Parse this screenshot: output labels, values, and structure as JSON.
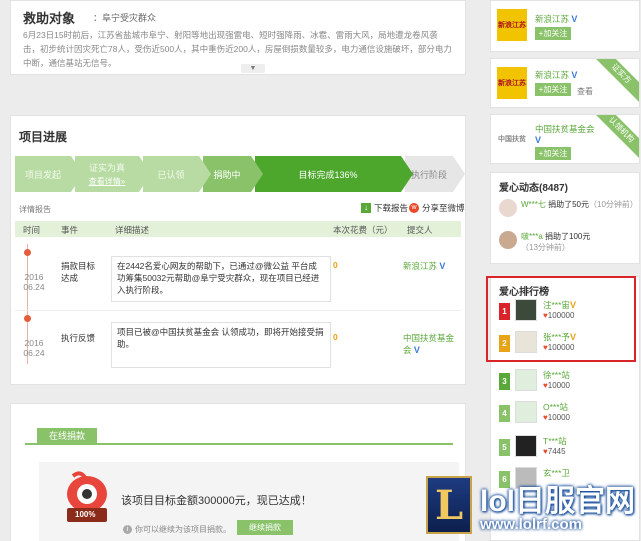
{
  "rescue": {
    "title": "救助对象",
    "subject": "：阜宁受灾群众",
    "description": "6月23日15时前后，江苏省盐城市阜宁、射阳等地出现强雷电、短时强降雨、冰雹、雷雨大风，局地遭龙卷风袭击，初步统计因灾死亡78人，受伤近500人，其中重伤近200人，房屋倒损数量较多，电力通信设施破坏，部分电力中断，通信基站无信号。"
  },
  "progress": {
    "title": "项目进展",
    "steps": [
      {
        "label": "项目发起",
        "sub": ""
      },
      {
        "label": "证实为真",
        "sub": "查看详情»"
      },
      {
        "label": "已认领",
        "sub": ""
      },
      {
        "label": "捐助中",
        "sub": ""
      },
      {
        "label": "目标完成136%",
        "sub": ""
      },
      {
        "label": "执行阶段",
        "sub": ""
      }
    ],
    "report_link": "详情报告",
    "download": "下载报告",
    "share": "分享至微博",
    "headers": {
      "time": "时间",
      "event": "事件",
      "detail": "详细描述",
      "cost": "本次花费（元）",
      "submitter": "提交人"
    },
    "rows": [
      {
        "year": "2016",
        "date": "06.24",
        "event": "捐款目标达成",
        "detail": "在2442名爱心网友的帮助下，已通过@微公益 平台成功筹集50032元帮助@阜宁受灾群众，现在项目已经进入执行阶段。",
        "cost": "0",
        "submitter": "新浪江苏"
      },
      {
        "year": "2016",
        "date": "06.24",
        "event": "执行反馈",
        "detail": "项目已被@中国扶贫基金会 认领成功，即将开始接受捐助。",
        "cost": "0",
        "submitter": "中国扶贫基金会"
      }
    ]
  },
  "donate": {
    "tab": "在线捐款",
    "badge": "100%",
    "message": "该项目目标金额300000元，现已达成！",
    "note": "你可以继续为该项目捐款。",
    "button": "继续捐款"
  },
  "orgs": [
    {
      "logo": "新浪江苏",
      "name": "新浪江苏",
      "follow": "+加关注",
      "view": "",
      "ribbon": ""
    },
    {
      "logo": "新浪江苏",
      "name": "新浪江苏",
      "follow": "+加关注",
      "view": "查看",
      "ribbon": "证实方"
    },
    {
      "logo": "中国扶贫",
      "name": "中国扶贫基金会",
      "follow": "+加关注",
      "view": "",
      "ribbon": "认领机构"
    }
  ],
  "dynamic": {
    "title": "爱心动态(8487)",
    "items": [
      {
        "user": "W***七",
        "action": " 捐助了50元",
        "time": "（10分钟前）"
      },
      {
        "user": "啵***a",
        "action": " 捐助了100元",
        "time": "（13分钟前）"
      }
    ]
  },
  "rank": {
    "title": "爱心排行榜",
    "items": [
      {
        "num": "1",
        "name": "注***宙",
        "value": "100000",
        "color": "#d9252a"
      },
      {
        "num": "2",
        "name": "张***予",
        "value": "100000",
        "color": "#e8a317"
      },
      {
        "num": "3",
        "name": "徐***站",
        "value": "10000",
        "color": "#5aa83a"
      },
      {
        "num": "4",
        "name": "O***站",
        "value": "10000",
        "color": "#8ac26a"
      },
      {
        "num": "5",
        "name": "T***站",
        "value": "7445",
        "color": "#8ac26a"
      },
      {
        "num": "6",
        "name": "玄***卫",
        "value": "",
        "color": "#8ac26a"
      }
    ]
  },
  "watermark": {
    "logo": "L",
    "title": "lol日服官网",
    "url": "www.lolrf.com"
  }
}
